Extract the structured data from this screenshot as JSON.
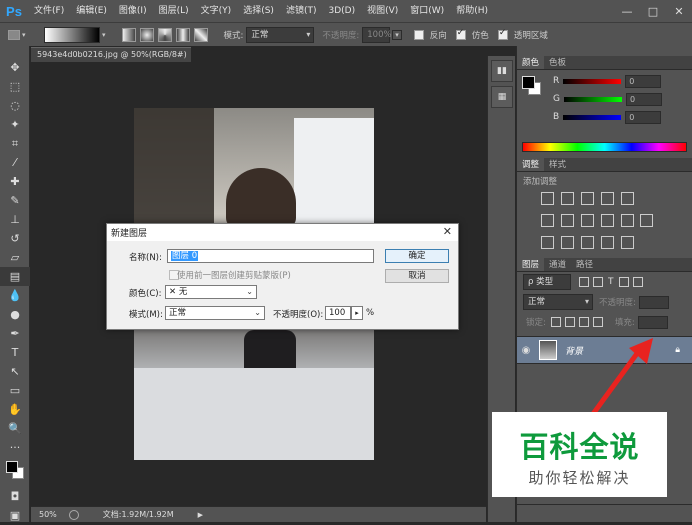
{
  "app": {
    "logo": "Ps"
  },
  "menu": [
    "文件(F)",
    "编辑(E)",
    "图像(I)",
    "图层(L)",
    "文字(Y)",
    "选择(S)",
    "滤镜(T)",
    "3D(D)",
    "视图(V)",
    "窗口(W)",
    "帮助(H)"
  ],
  "window_controls": {
    "minimize": "—",
    "restore": "□",
    "close": "✕"
  },
  "options": {
    "mode_label": "模式:",
    "mode_value": "正常",
    "opacity_label": "不透明度:",
    "opacity_value": "100%",
    "reverse_label": "反向",
    "dither_label": "仿色",
    "transparency_label": "透明区域"
  },
  "document": {
    "tab_title": "5943e4d0b0216.jpg @ 50%(RGB/8#)",
    "tab_close": "×",
    "zoom": "50%",
    "doc_info": "文档:1.92M/1.92M"
  },
  "color_panel": {
    "tabs": [
      "颜色",
      "色板"
    ],
    "channels": [
      {
        "label": "R",
        "value": "0"
      },
      {
        "label": "G",
        "value": "0"
      },
      {
        "label": "B",
        "value": "0"
      }
    ]
  },
  "adjust_panel": {
    "tabs": [
      "调整",
      "样式"
    ],
    "add_label": "添加调整"
  },
  "layers_panel": {
    "tabs": [
      "图层",
      "通道",
      "路径"
    ],
    "filter_label": "ρ 类型",
    "blend_mode": "正常",
    "opacity_label": "不透明度:",
    "lock_label": "锁定:",
    "fill_label": "填充:",
    "layer_name": "背景"
  },
  "dialog": {
    "title": "新建图层",
    "name_label": "名称(N):",
    "name_value": "图层 0",
    "clip_label": "使用前一图层创建剪贴蒙版(P)",
    "color_label": "颜色(C):",
    "color_value": "无",
    "color_prefix": "✕",
    "mode_label": "模式(M):",
    "mode_value": "正常",
    "opacity_label": "不透明度(O):",
    "opacity_value": "100",
    "opacity_unit": "%",
    "ok_label": "确定",
    "cancel_label": "取消"
  },
  "watermark": {
    "title": "百科全说",
    "subtitle": "助你轻松解决"
  },
  "colors": {
    "accent": "#31a8ff",
    "layer_selected": "#6c7d94",
    "arrow": "#e8231f",
    "watermark_green": "#0e9a3c"
  }
}
